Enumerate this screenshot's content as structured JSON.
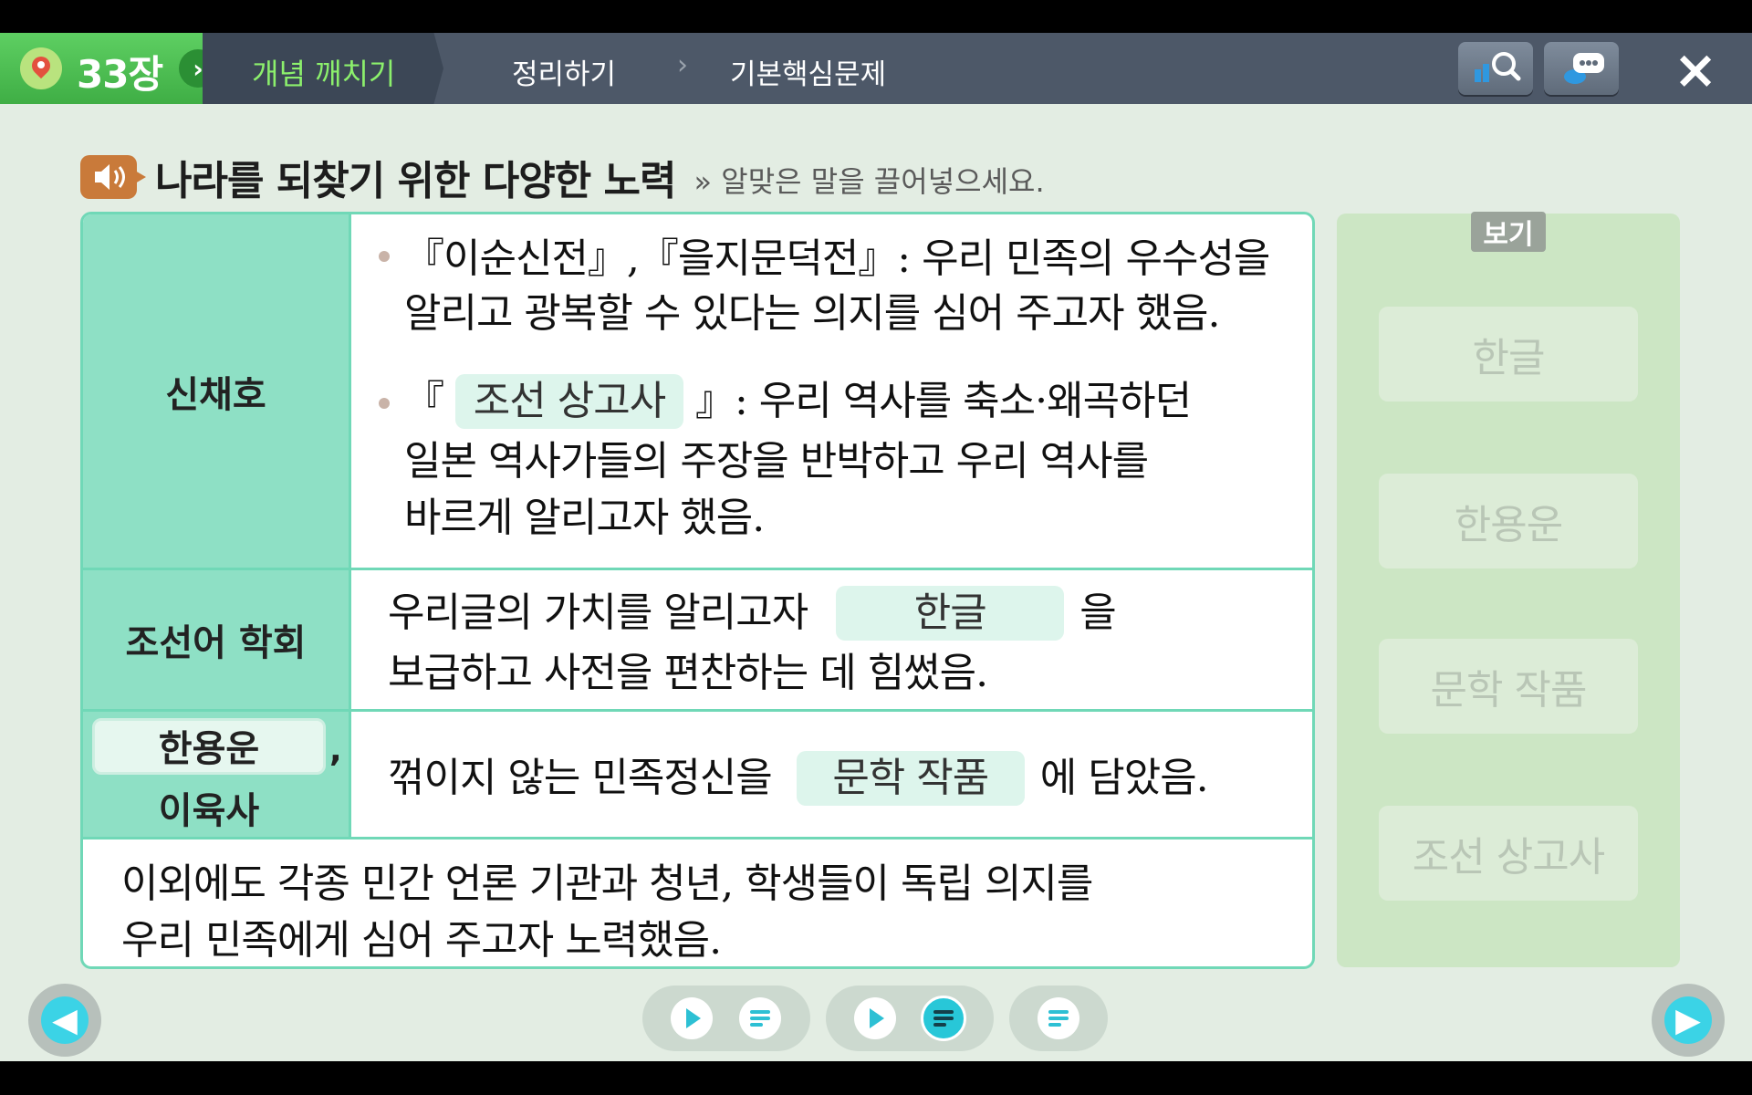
{
  "header": {
    "chapter": "33장",
    "tabs": [
      "개념 깨치기",
      "정리하기",
      "기본핵심문제"
    ],
    "active_tab": "개념 깨치기"
  },
  "title": {
    "text": "나라를 되찾기 위한 다양한 노력",
    "instruction": "» 알맞은 말을 끌어넣으세요."
  },
  "table": {
    "shin": {
      "header": "신채호",
      "b1_l1": "『이순신전』,『을지문덕전』: 우리 민족의 우수성을",
      "b1_l2": "알리고 광복할 수 있다는 의지를 심어 주고자 했음.",
      "b2_open": "『",
      "b2_blank": "조선 상고사",
      "b2_rest": "』: 우리 역사를 축소·왜곡하던",
      "b2_l2": "일본 역사가들의 주장을 반박하고 우리 역사를",
      "b2_l3": "바르게 알리고자 했음."
    },
    "joseon": {
      "header": "조선어 학회",
      "l1_pre": "우리글의 가치를 알리고자",
      "l1_blank": "한글",
      "l1_post": "을",
      "l2": "보급하고 사전을 편찬하는 데 힘썼음."
    },
    "han": {
      "header_blank": "한용운",
      "header_comma": ",",
      "header_2": "이육사",
      "pre": "꺾이지 않는 민족정신을",
      "blank": "문학 작품",
      "post": "에 담았음."
    },
    "footer": {
      "l1": "이외에도 각종 민간 언론 기관과 청년, 학생들이 독립 의지를",
      "l2": "우리 민족에게 심어 주고자 노력했음."
    }
  },
  "bank": {
    "label": "보기",
    "items": [
      "한글",
      "한용운",
      "문학 작품",
      "조선 상고사"
    ]
  },
  "colors": {
    "accent_green": "#70d8b7",
    "header_fill": "#8ee0c5",
    "nav_bg": "#4d5868",
    "active_tab_text": "#8cf06c"
  }
}
